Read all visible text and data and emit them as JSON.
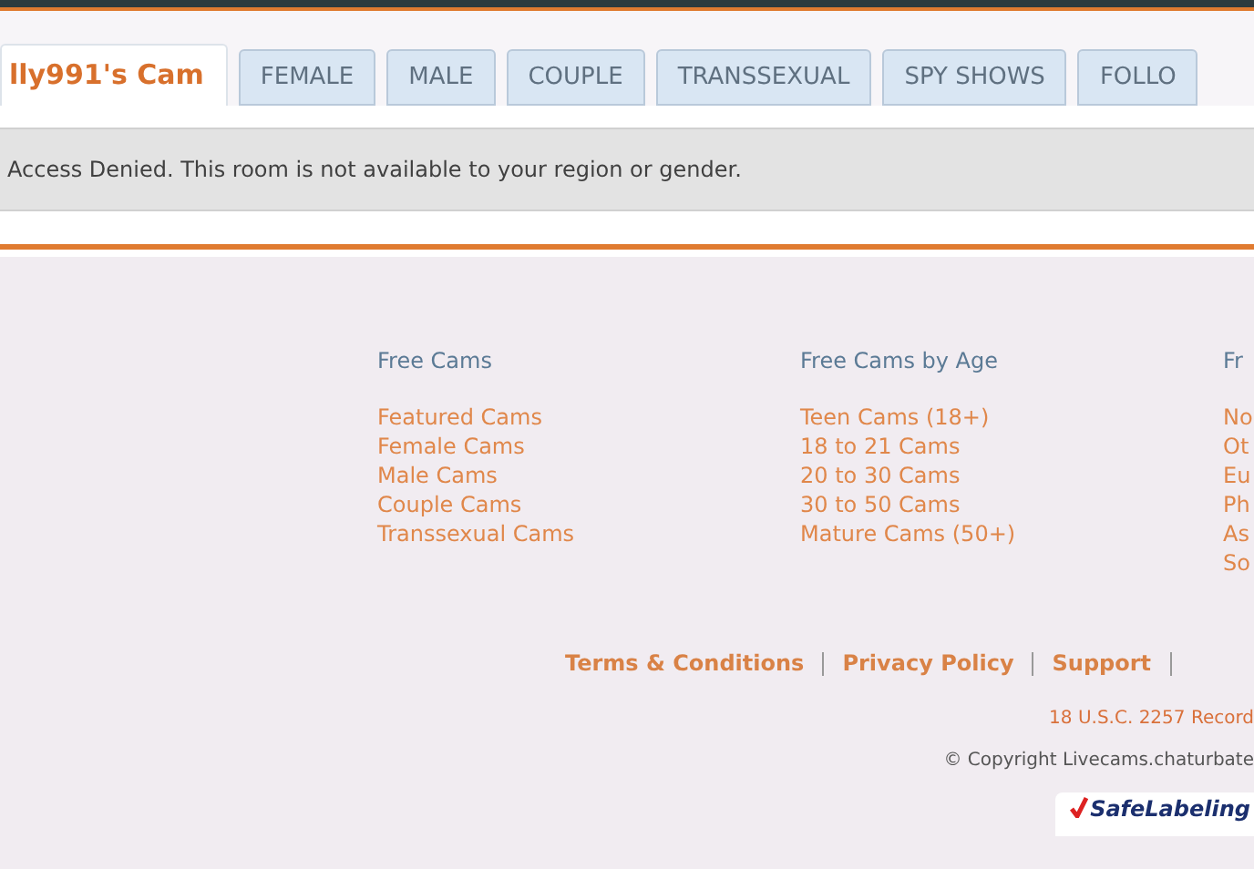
{
  "tabs": [
    {
      "label": "lly991's Cam",
      "selected": true
    },
    {
      "label": "FEMALE",
      "selected": false
    },
    {
      "label": "MALE",
      "selected": false
    },
    {
      "label": "COUPLE",
      "selected": false
    },
    {
      "label": "TRANSSEXUAL",
      "selected": false
    },
    {
      "label": "SPY SHOWS",
      "selected": false
    },
    {
      "label": "FOLLO",
      "selected": false
    }
  ],
  "message": "Access Denied. This room is not available to your region or gender.",
  "footer_columns": [
    {
      "heading": "Free Cams",
      "links": [
        "Featured Cams",
        "Female Cams",
        "Male Cams",
        "Couple Cams",
        "Transsexual Cams"
      ]
    },
    {
      "heading": "Free Cams by Age",
      "links": [
        "Teen Cams (18+)",
        "18 to 21 Cams",
        "20 to 30 Cams",
        "30 to 50 Cams",
        "Mature Cams (50+)"
      ]
    },
    {
      "heading": "Fr",
      "links": [
        "No",
        "Ot",
        "Eu",
        "Ph",
        "As",
        "So"
      ]
    }
  ],
  "footer_links": [
    "Terms & Conditions",
    "Privacy Policy",
    "Support"
  ],
  "records_note": "18 U.S.C. 2257 Record",
  "copyright": "© Copyright Livecams.chaturbate",
  "badge": "SafeLabeling"
}
